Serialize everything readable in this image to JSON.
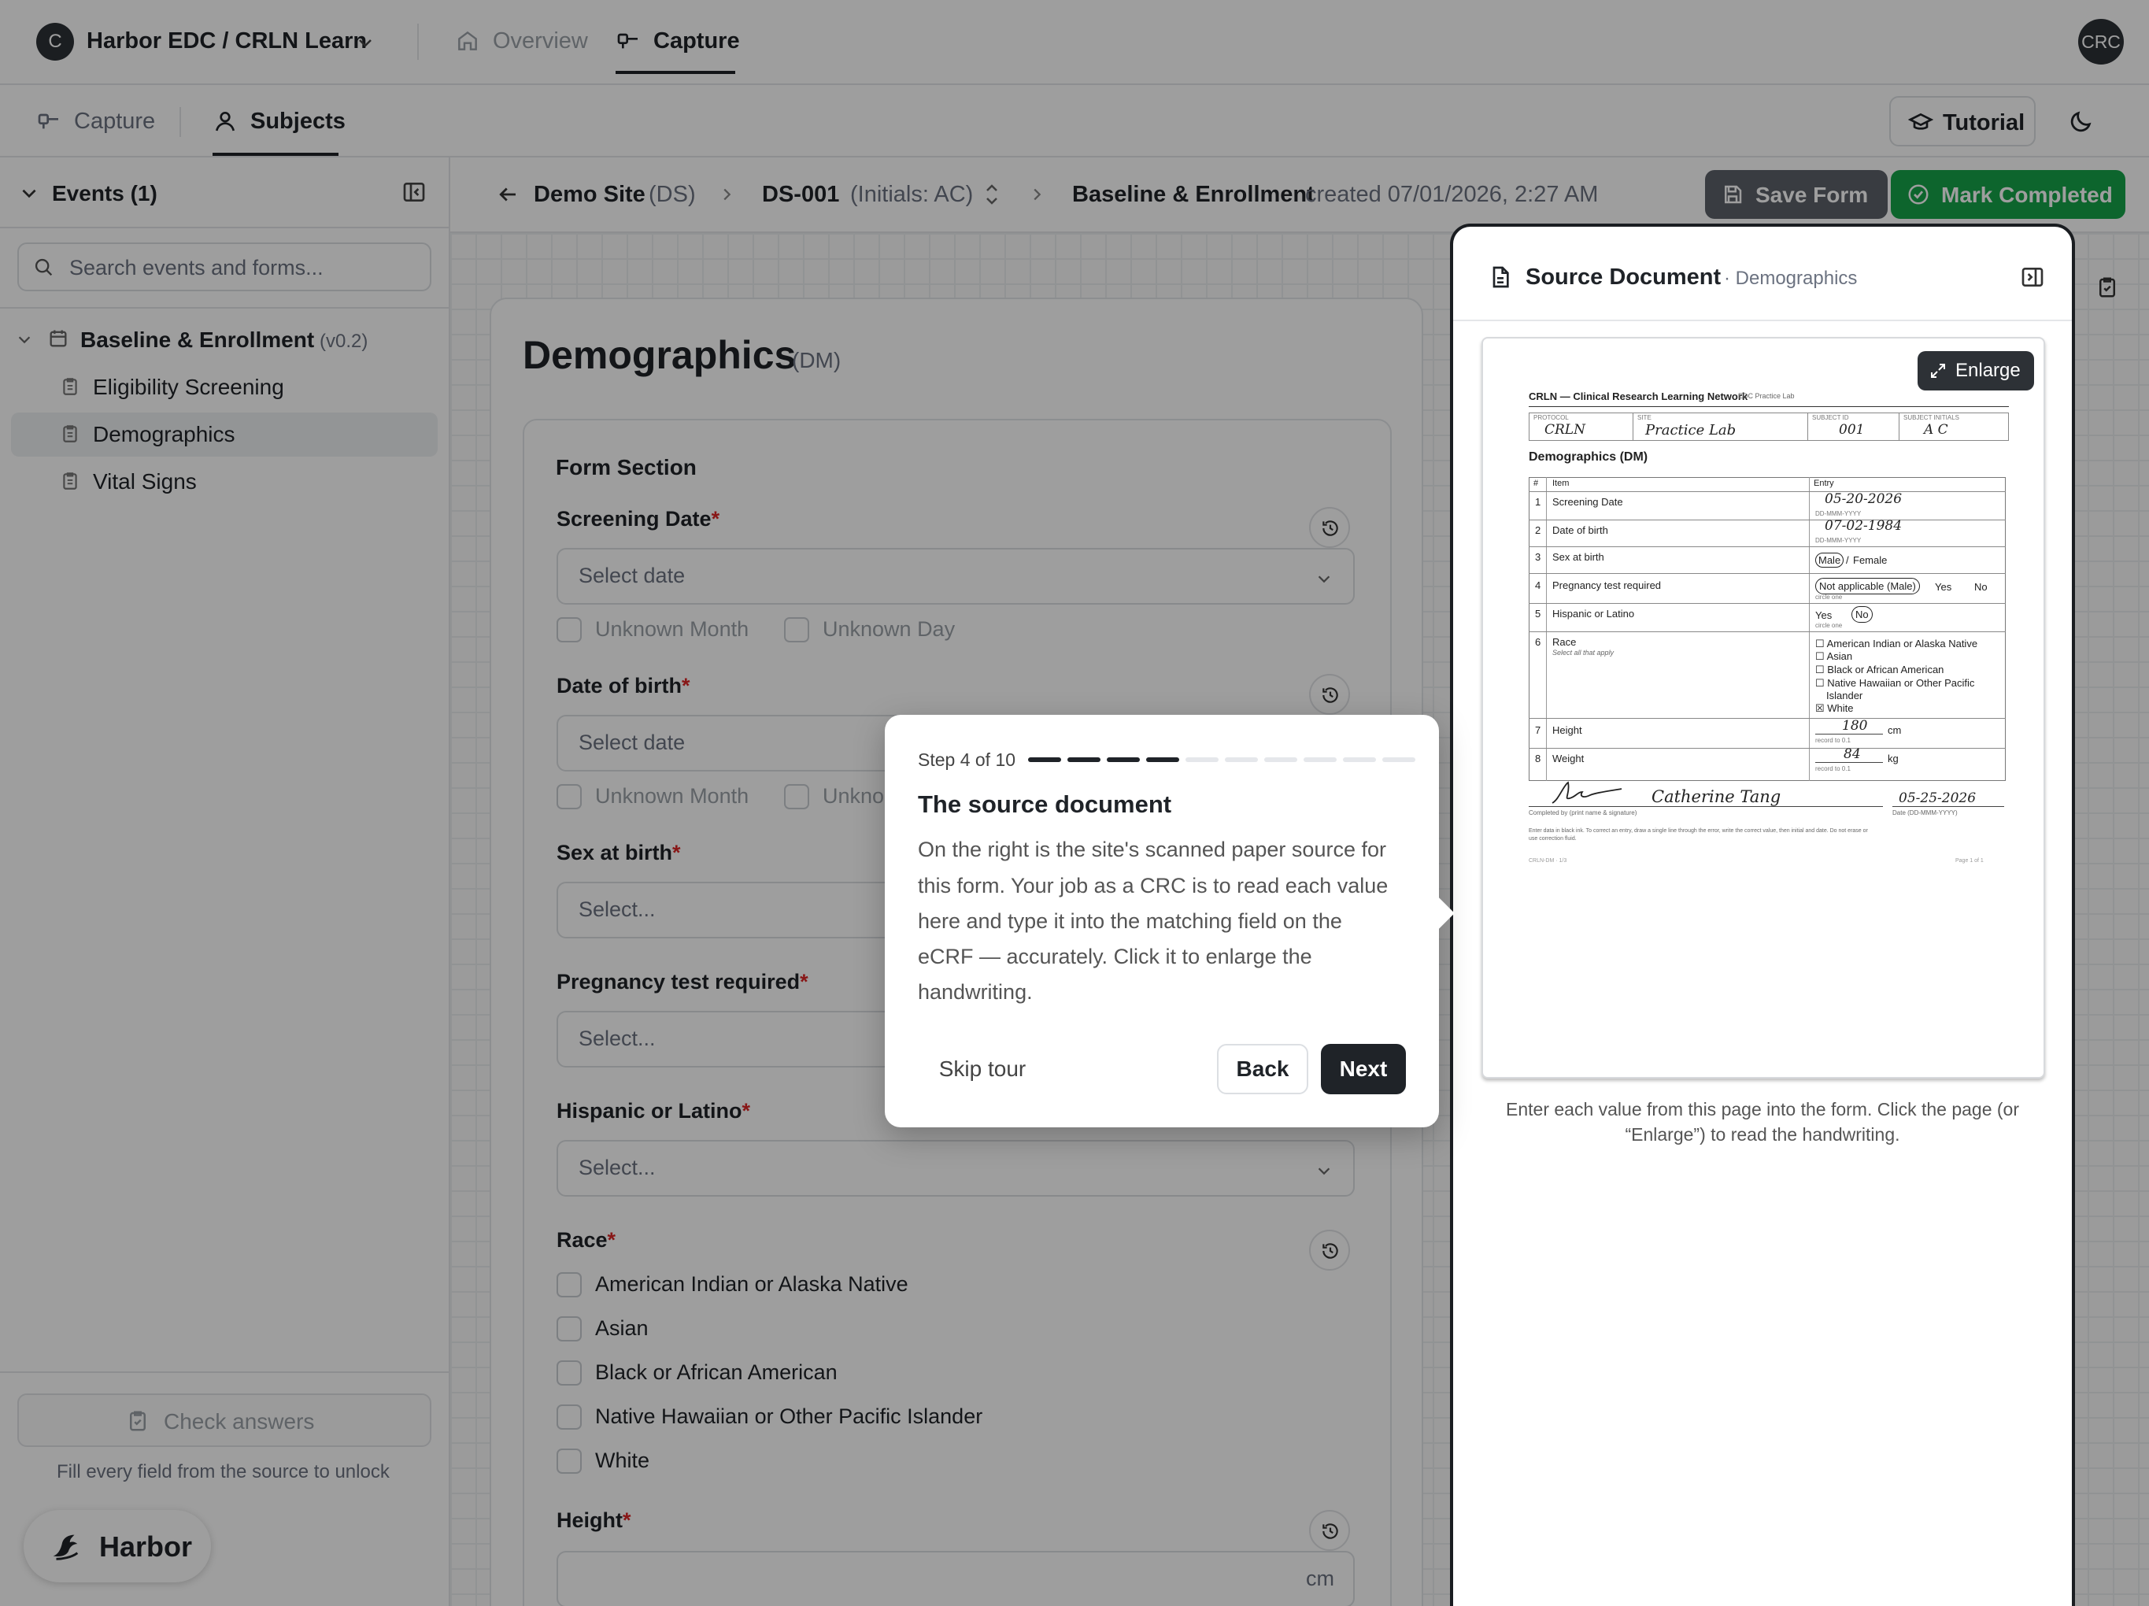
{
  "app": {
    "avatar_initial": "C",
    "title": "Harbor EDC / CRLN Learn",
    "user_initials": "CRC"
  },
  "topnav": {
    "overview": "Overview",
    "capture": "Capture"
  },
  "subnav": {
    "capture": "Capture",
    "subjects": "Subjects",
    "tutorial": "Tutorial"
  },
  "sidebar": {
    "events_title": "Events (1)",
    "search_placeholder": "Search events and forms...",
    "event": {
      "name": "Baseline & Enrollment",
      "version": "(v0.2)"
    },
    "forms": [
      "Eligibility Screening",
      "Demographics",
      "Vital Signs"
    ],
    "check_answers": "Check answers",
    "check_hint": "Fill every field from the source to unlock",
    "brand": "Harbor"
  },
  "breadcrumb": {
    "site": "Demo Site",
    "site_code": "(DS)",
    "subject": "DS-001",
    "initials": "(Initials: AC)",
    "event": "Baseline & Enrollment",
    "created": "created 07/01/2026, 2:27 AM",
    "save_form": "Save Form",
    "mark_completed": "Mark Completed"
  },
  "form": {
    "title": "Demographics",
    "code": "(DM)",
    "section": "Form Section",
    "screening_date": {
      "label": "Screening Date",
      "placeholder": "Select date"
    },
    "dob": {
      "label": "Date of birth",
      "placeholder": "Select date"
    },
    "unknown_month": "Unknown Month",
    "unknown_day": "Unknown Day",
    "unknown_day_partial": "Unkno",
    "sex": {
      "label": "Sex at birth",
      "placeholder": "Select..."
    },
    "pregnancy": {
      "label": "Pregnancy test required",
      "placeholder": "Select..."
    },
    "hispanic": {
      "label": "Hispanic or Latino",
      "placeholder": "Select..."
    },
    "race": {
      "label": "Race",
      "options": [
        "American Indian or Alaska Native",
        "Asian",
        "Black or African American",
        "Native Hawaiian or Other Pacific Islander",
        "White"
      ]
    },
    "height": {
      "label": "Height",
      "unit": "cm"
    },
    "required_mark": "*"
  },
  "source": {
    "title": "Source Document",
    "subtitle": "· Demographics",
    "enlarge": "Enlarge",
    "caption_line1": "Enter each value from this page into the form. Click the page (or",
    "caption_line2": "“Enlarge”) to read the handwriting.",
    "doc": {
      "header": "CRLN — Clinical Research Learning Network",
      "header_small": "EDC Practice Lab",
      "protocol_label": "PROTOCOL",
      "protocol": "CRLN",
      "site_label": "SITE",
      "site": "Practice Lab",
      "subject_label": "SUBJECT ID",
      "subject": "001",
      "initials_label": "SUBJECT INITIALS",
      "initials": "A C",
      "section_title": "Demographics (DM)",
      "col_num": "#",
      "col_item": "Item",
      "col_entry": "Entry",
      "items": [
        "Screening Date",
        "Date of birth",
        "Sex at birth",
        "Pregnancy test required",
        "Hispanic or Latino",
        "Race",
        "Height",
        "Weight"
      ],
      "race_hint": "Select all that apply",
      "screening_value": "05-20-2026",
      "dob_value": "07-02-1984",
      "date_hint": "DD-MMM-YYYY",
      "sex_male": "Male",
      "sex_female": "Female",
      "preg_na": "Not applicable (Male)",
      "preg_yes": "Yes",
      "preg_no": "No",
      "circle_one": "circle one",
      "hisp_yes": "Yes",
      "hisp_no": "No",
      "race_options": [
        "American Indian or Alaska Native",
        "Asian",
        "Black or African American",
        "Native Hawaiian or Other Pacific",
        "Islander",
        "White"
      ],
      "height_value": "180",
      "height_unit": "cm",
      "weight_value": "84",
      "weight_unit": "kg",
      "record_hint": "record to 0.1",
      "signature_name": "Catherine Tang",
      "signature_date": "05-25-2026",
      "completed_by": "Completed by (print name & signature)",
      "date_label": "Date (DD-MMM-YYYY)",
      "footnote_1": "Enter data in black ink. To correct an entry, draw a single line through the error, write the correct value, then initial and date. Do not erase or",
      "footnote_2": "use correction fluid.",
      "form_code": "CRLN-DM · 1/3",
      "page": "Page 1 of 1"
    }
  },
  "tour": {
    "step": "Step 4 of 10",
    "step_current": 4,
    "step_total": 10,
    "title": "The source document",
    "body_lines": [
      "On the right is the site's scanned paper source for",
      "this form. Your job as a CRC is to read each value",
      "here and type it into the matching field on the",
      "eCRF — accurately. Click it to enlarge the",
      "handwriting."
    ],
    "skip": "Skip tour",
    "back": "Back",
    "next": "Next"
  },
  "colors": {
    "accent": "#16a34a",
    "dark": "#1f2328",
    "required": "#dc2626"
  }
}
